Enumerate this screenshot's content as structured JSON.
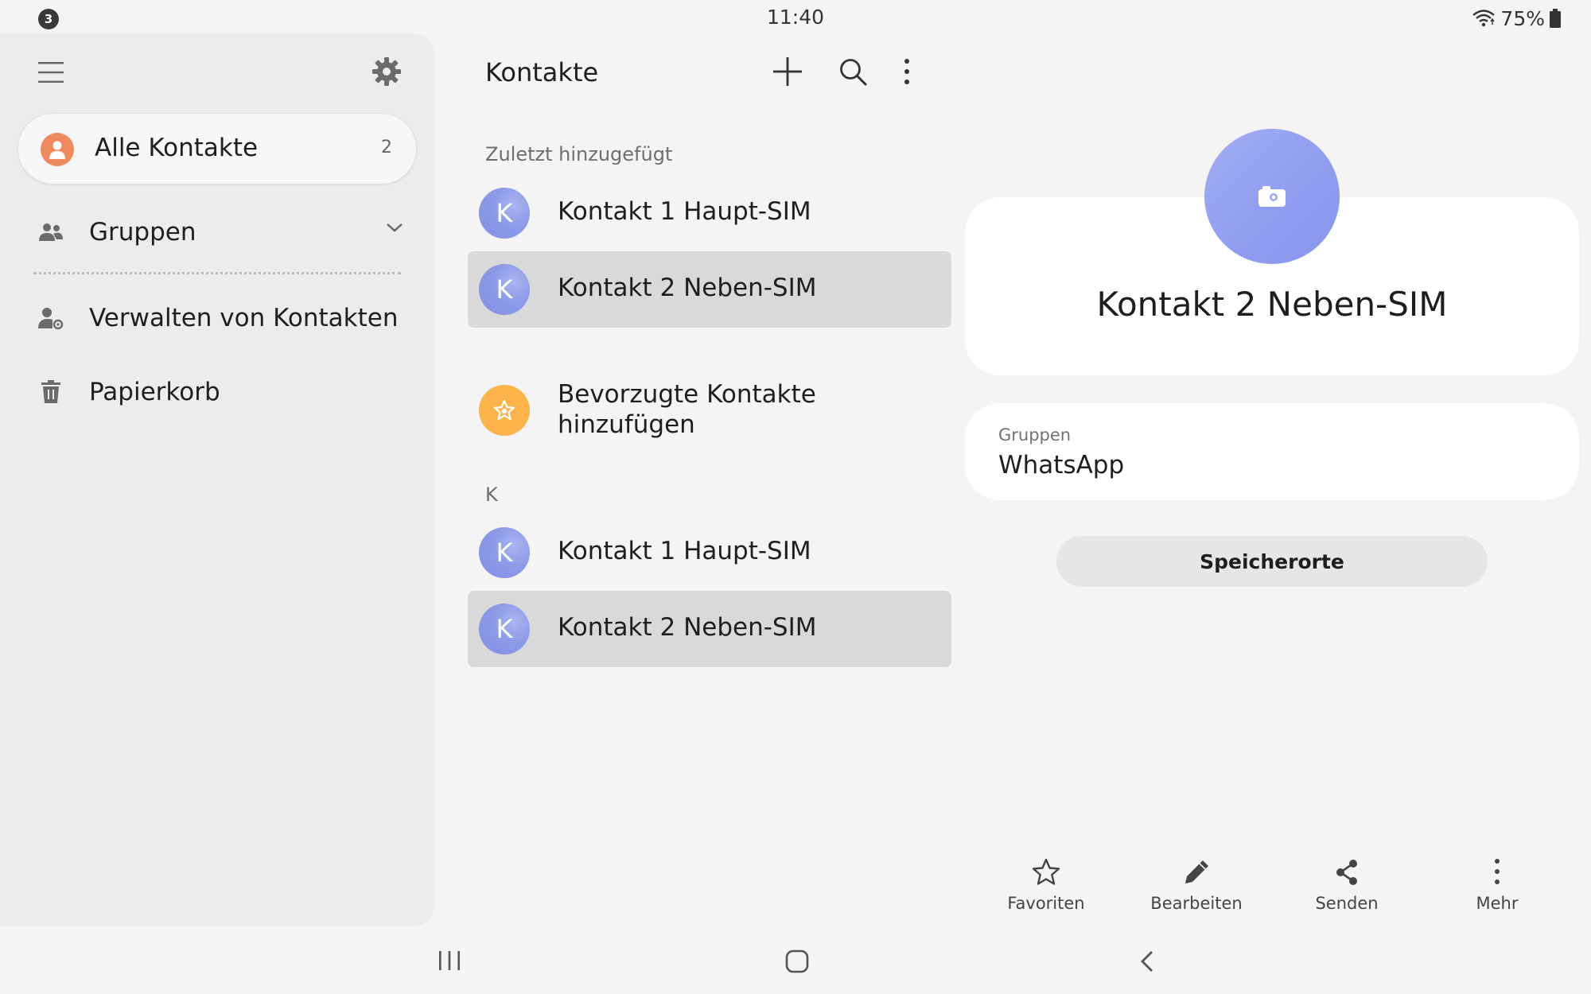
{
  "status_bar": {
    "notification_count": "3",
    "time": "11:40",
    "battery": "75%",
    "icons": [
      "wifi-icon",
      "battery-icon"
    ]
  },
  "sidebar": {
    "all_contacts": {
      "label": "Alle Kontakte",
      "count": "2"
    },
    "items": [
      {
        "label": "Gruppen",
        "icon": "group-icon"
      },
      {
        "label": "Verwalten von Kontakten",
        "icon": "manage-contacts-icon"
      },
      {
        "label": "Papierkorb",
        "icon": "trash-icon"
      }
    ]
  },
  "contacts_list": {
    "title": "Kontakte",
    "sections": [
      {
        "header": "Zuletzt hinzugefügt",
        "items": [
          {
            "initial": "K",
            "name": "Kontakt 1 Haupt-SIM",
            "selected": false
          },
          {
            "initial": "K",
            "name": "Kontakt 2 Neben-SIM",
            "selected": true
          }
        ]
      },
      {
        "header": "K",
        "items": [
          {
            "initial": "K",
            "name": "Kontakt 1 Haupt-SIM",
            "selected": false
          },
          {
            "initial": "K",
            "name": "Kontakt 2 Neben-SIM",
            "selected": true
          }
        ]
      }
    ],
    "favorites_prompt": "Bevorzugte Kontakte hinzufügen"
  },
  "detail": {
    "name": "Kontakt 2 Neben-SIM",
    "groups_label": "Gruppen",
    "groups_value": "WhatsApp",
    "storage_button": "Speicherorte",
    "actions": [
      {
        "label": "Favoriten",
        "icon": "star-icon"
      },
      {
        "label": "Bearbeiten",
        "icon": "pencil-icon"
      },
      {
        "label": "Senden",
        "icon": "share-icon"
      },
      {
        "label": "Mehr",
        "icon": "more-vert-icon"
      }
    ]
  },
  "colors": {
    "background": "#f4f4f4",
    "sidebar": "#ececec",
    "selected_row": "#d9d9d9",
    "avatar_blue": "#8c9ae8",
    "avatar_orange": "#ef8a5c",
    "avatar_yellow": "#fbb44a"
  }
}
